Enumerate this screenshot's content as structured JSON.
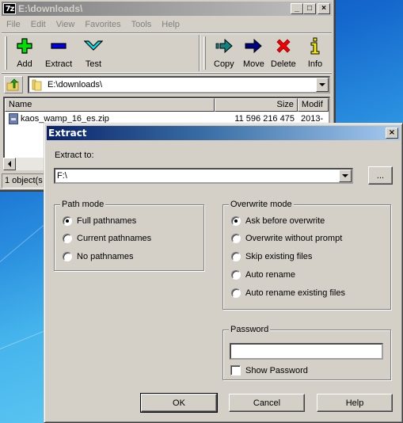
{
  "main_window": {
    "title": "E:\\downloads\\",
    "app_icon_text": "7z",
    "window_controls": {
      "minimize": "_",
      "maximize": "□",
      "close": "×"
    },
    "menu": [
      "File",
      "Edit",
      "View",
      "Favorites",
      "Tools",
      "Help"
    ],
    "toolbar": [
      {
        "label": "Add",
        "icon": "plus-icon",
        "color": "#00e000"
      },
      {
        "label": "Extract",
        "icon": "minus-icon",
        "color": "#0000e0"
      },
      {
        "label": "Test",
        "icon": "check-chevron-icon",
        "color": "#00e8f0"
      },
      {
        "label": "Copy",
        "icon": "copy-arrow-icon",
        "color": "#108080"
      },
      {
        "label": "Move",
        "icon": "move-arrow-icon",
        "color": "#000080"
      },
      {
        "label": "Delete",
        "icon": "delete-x-icon",
        "color": "#f00000"
      },
      {
        "label": "Info",
        "icon": "info-icon",
        "color": "#f8f000"
      }
    ],
    "address": "E:\\downloads\\",
    "columns": [
      "Name",
      "Size",
      "Modif"
    ],
    "files": [
      {
        "name": "kaos_wamp_16_es.zip",
        "size": "11 596 216 475",
        "modified": "2013-"
      }
    ],
    "status": "1 object(s"
  },
  "extract_dialog": {
    "title": "Extract",
    "close_glyph": "×",
    "extract_to_label": "Extract to:",
    "extract_to_value": "F:\\",
    "browse_label": "...",
    "path_mode": {
      "legend": "Path mode",
      "options": [
        "Full pathnames",
        "Current pathnames",
        "No pathnames"
      ],
      "selected": "Full pathnames"
    },
    "overwrite_mode": {
      "legend": "Overwrite mode",
      "options": [
        "Ask before overwrite",
        "Overwrite without prompt",
        "Skip existing files",
        "Auto rename",
        "Auto rename existing files"
      ],
      "selected": "Ask before overwrite"
    },
    "password": {
      "legend": "Password",
      "value": "",
      "show_password_label": "Show Password",
      "show_password_checked": false
    },
    "buttons": {
      "ok": "OK",
      "cancel": "Cancel",
      "help": "Help"
    }
  }
}
